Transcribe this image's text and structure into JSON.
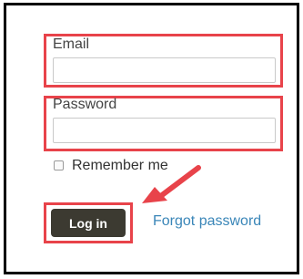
{
  "form": {
    "email_label": "Email",
    "email_value": "",
    "password_label": "Password",
    "password_value": "",
    "remember_label": "Remember me",
    "remember_checked": false,
    "login_label": "Log in",
    "forgot_label": "Forgot password"
  },
  "annotation": {
    "highlight_color": "#e8434a",
    "arrow_target": "login-button"
  },
  "colors": {
    "button_bg": "#3c3a31",
    "link": "#3a86b8"
  }
}
